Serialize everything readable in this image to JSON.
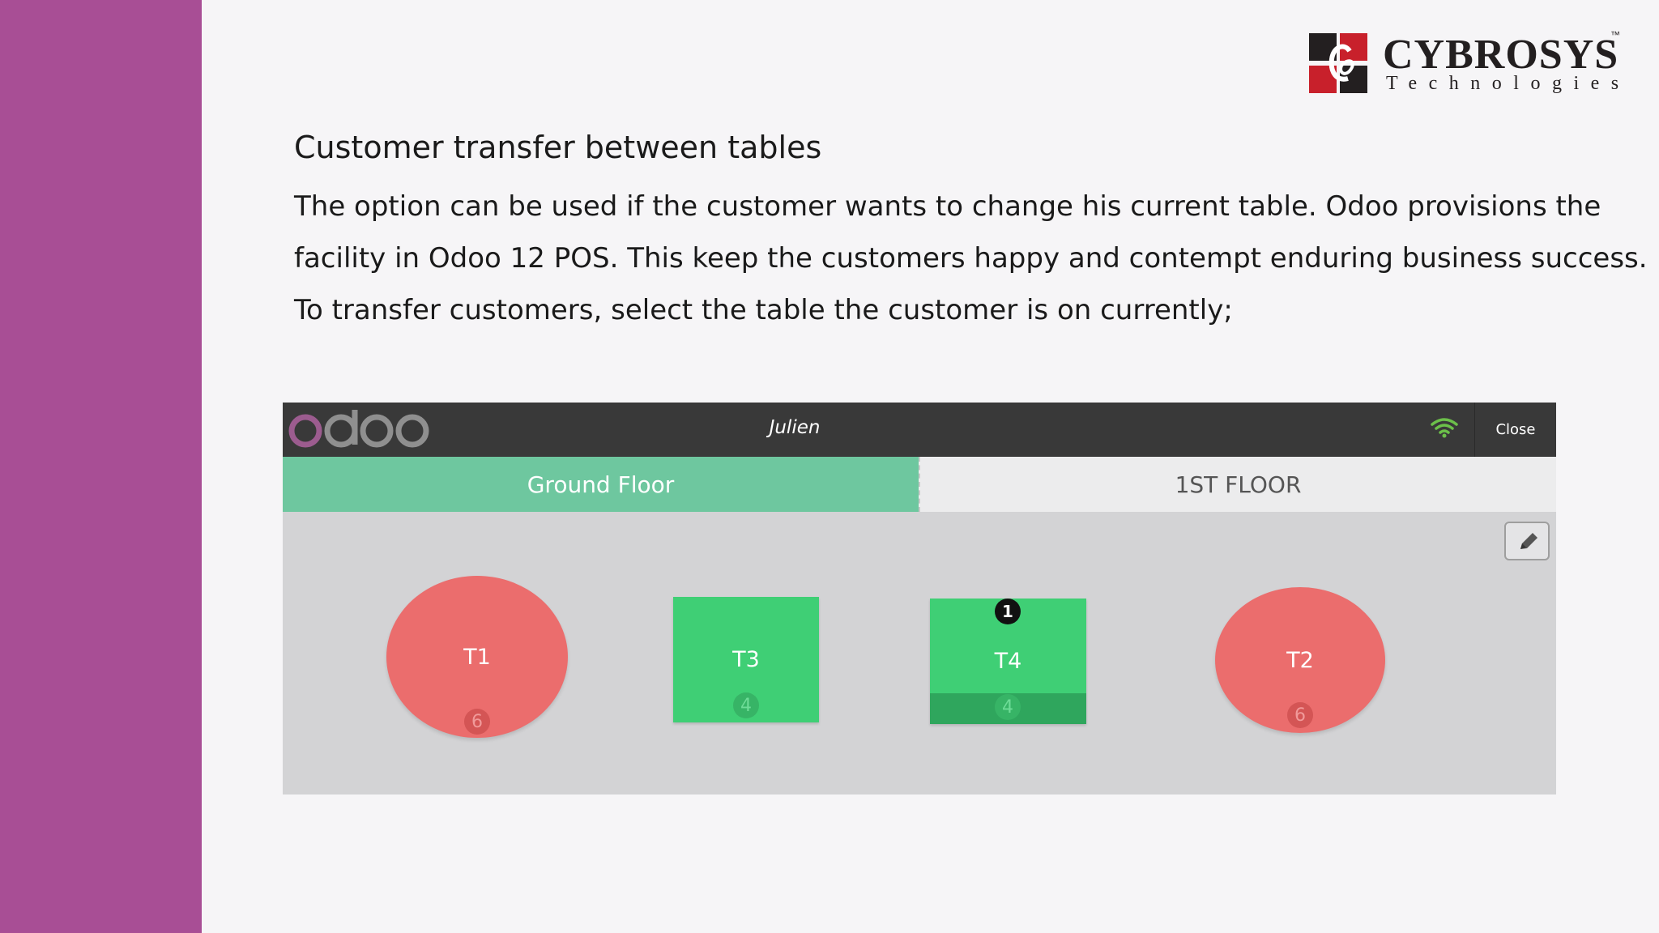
{
  "brand": {
    "name": "CYBROSYS",
    "trademark": "™",
    "subtitle": "Technologies",
    "colors": {
      "sidebar": "#a84e95",
      "logo_red": "#c8202b",
      "logo_black": "#231f20"
    }
  },
  "slide": {
    "heading": "Customer transfer between tables",
    "paragraph_lines": [
      "The option can be used if the customer wants to change his current table. Odoo provisions the",
      "facility in Odoo 12 POS. This keep the customers happy and contempt enduring business success.",
      "To transfer customers, select the table the customer is on currently;"
    ]
  },
  "pos": {
    "logo_icon": "odoo-logo",
    "user": "Julien",
    "connection_icon": "wifi-icon",
    "close_label": "Close",
    "tabs": [
      {
        "label": "Ground Floor",
        "active": true,
        "color": "#6ec79f"
      },
      {
        "label": "1ST FLOOR",
        "active": false
      }
    ],
    "edit_icon": "pencil-icon",
    "tables": [
      {
        "name": "T1",
        "shape": "round",
        "seats": "6",
        "color": "#eb6d6d"
      },
      {
        "name": "T3",
        "shape": "square",
        "seats": "4",
        "color": "#3fcf75"
      },
      {
        "name": "T4",
        "shape": "square",
        "seats": "4",
        "color": "#3fcf75",
        "orders": "1"
      },
      {
        "name": "T2",
        "shape": "round",
        "seats": "6",
        "color": "#eb6d6d"
      }
    ]
  }
}
